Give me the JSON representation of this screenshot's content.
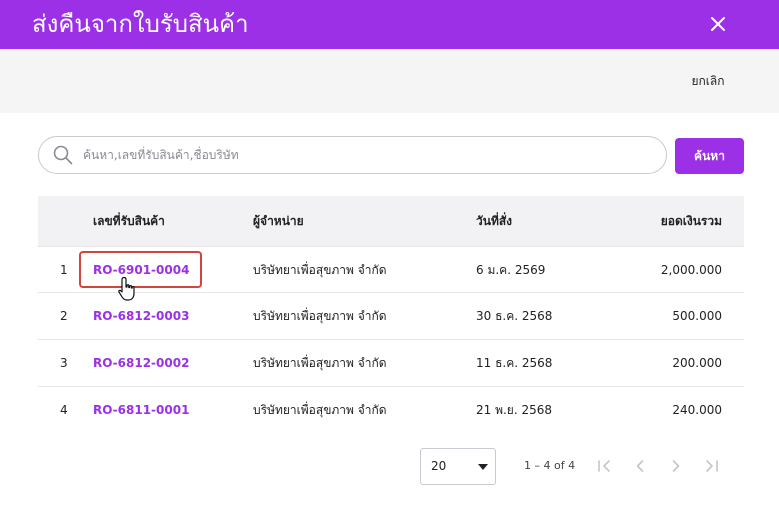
{
  "dialog": {
    "title": "ส่งคืนจากใบรับสินค้า",
    "close_icon": "close-icon"
  },
  "toolbar": {
    "cancel_label": "ยกเลิก"
  },
  "search": {
    "placeholder": "ค้นหา,เลขที่รับสินค้า,ชื่อบริษัท",
    "value": "",
    "button_label": "ค้นหา",
    "icon": "search-icon"
  },
  "table": {
    "columns": [
      "",
      "เลขที่รับสินค้า",
      "ผู้จำหน่าย",
      "วันที่สั่ง",
      "ยอดเงินรวม"
    ],
    "rows": [
      {
        "index": "1",
        "code": "RO-6901-0004",
        "vendor": "บริษัทยาเพื่อสุขภาพ จำกัด",
        "date": "6 ม.ค. 2569",
        "total": "2,000.000"
      },
      {
        "index": "2",
        "code": "RO-6812-0003",
        "vendor": "บริษัทยาเพื่อสุขภาพ จำกัด",
        "date": "30 ธ.ค. 2568",
        "total": "500.000"
      },
      {
        "index": "3",
        "code": "RO-6812-0002",
        "vendor": "บริษัทยาเพื่อสุขภาพ จำกัด",
        "date": "11 ธ.ค. 2568",
        "total": "200.000"
      },
      {
        "index": "4",
        "code": "RO-6811-0001",
        "vendor": "บริษัทยาเพื่อสุขภาพ จำกัด",
        "date": "21 พ.ย. 2568",
        "total": "240.000"
      }
    ]
  },
  "pagination": {
    "page_size": "20",
    "range_label": "1 – 4 of 4",
    "icons": [
      "first-page-icon",
      "previous-page-icon",
      "next-page-icon",
      "last-page-icon"
    ]
  },
  "colors": {
    "brand": "#9b30e6",
    "highlight": "#d0463e"
  }
}
